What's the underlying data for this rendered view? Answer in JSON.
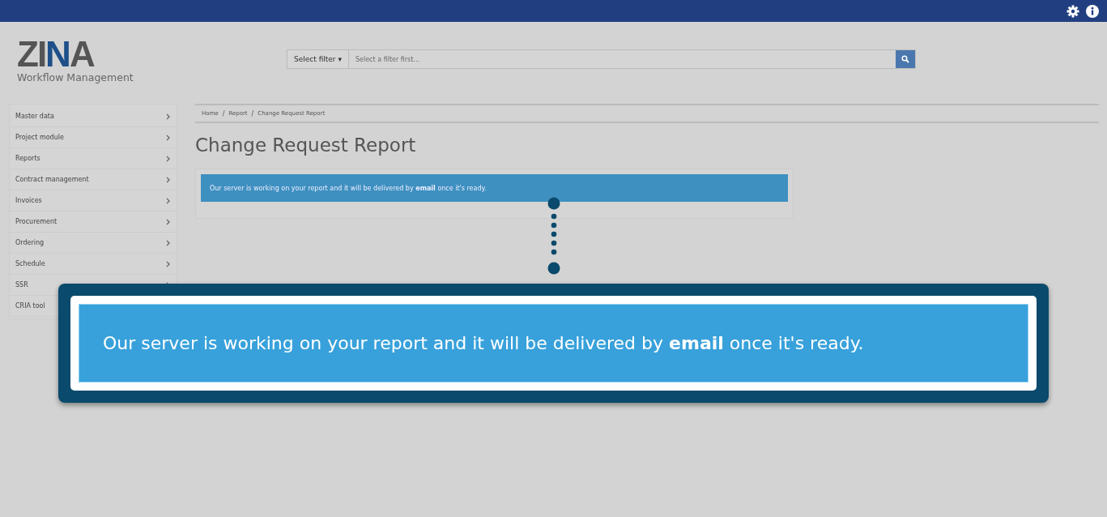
{
  "logo": {
    "mark": "ZINA",
    "subtitle": "Workflow Management"
  },
  "search": {
    "filter_button": "Select filter",
    "filter_caret": "▾",
    "placeholder": "Select a filter first..."
  },
  "sidebar": {
    "items": [
      {
        "label": "Master data",
        "submenu": true
      },
      {
        "label": "Project module",
        "submenu": true
      },
      {
        "label": "Reports",
        "submenu": true
      },
      {
        "label": "Contract management",
        "submenu": true
      },
      {
        "label": "Invoices",
        "submenu": true
      },
      {
        "label": "Procurement",
        "submenu": true
      },
      {
        "label": "Ordering",
        "submenu": true
      },
      {
        "label": "Schedule",
        "submenu": true
      },
      {
        "label": "SSR",
        "submenu": true
      },
      {
        "label": "CRIA tool",
        "submenu": false
      }
    ]
  },
  "breadcrumbs": {
    "separator": "/",
    "items": [
      "Home",
      "Report",
      "Change Request Report"
    ]
  },
  "page_title": "Change Request Report",
  "alert": "Our server is working on your report and it will be delivered by **email** once it's ready.",
  "callout": {
    "text": "Our server is working on your report and it will be delivered by **email** once it's ready."
  }
}
